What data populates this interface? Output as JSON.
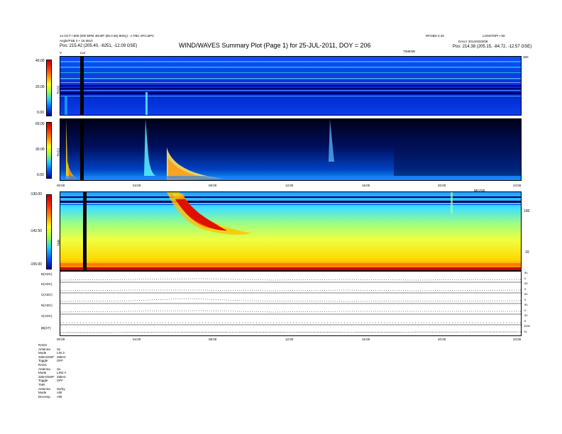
{
  "header": {
    "title": "WIND/WAVES Summary Plot (Page 1) for 25-JUL-2011, DOY = 206",
    "left_line1": "14 OCT • 805 (000 BPM 4M.BP (80.0 80) 80Gy) - A FBC 0FG.BPC",
    "left_line2": "Angle/FSB 3 + 15 0810",
    "left_line3": "Pos: 215.42 (205.40, -8251, -12.09 GSE)",
    "right_line1": "RFOBD 0.40",
    "right_line1b": "LOSSTOPI • 50",
    "right_line2": "DAILY 2014/2020/08",
    "right_line3": "Pos: 214.38 (205.15, -84.72, -12.57 GSE)",
    "time_label": "TIMENR",
    "cal_label": "Cal",
    "corner_left": "V",
    "corner_right": "360"
  },
  "panels": {
    "rad2": {
      "name": "RAD2",
      "ticks": [
        "40.00",
        "20.00",
        "0.00"
      ]
    },
    "rad1": {
      "name": "RAD1",
      "ticks": [
        "60.00",
        "30.00",
        "0.00"
      ]
    },
    "tnr": {
      "name": "TNR",
      "ticks": [
        "-130.00",
        "-142.50",
        "-155.00"
      ],
      "right_ticks": [
        "100",
        "10"
      ]
    },
    "time_ticks_top": [
      "00:00",
      "04:00",
      "08:00",
      "12:00",
      "16:00",
      "20:00",
      "24:00"
    ],
    "time_ticks_bottom": [
      "00:00",
      "04:00",
      "08:00",
      "12:00",
      "16:00",
      "20:00",
      "24:00"
    ],
    "tnr_top_label": "BEVOE",
    "line_panels": [
      {
        "label": "B(ADC)",
        "right": [
          "50",
          "20",
          "0"
        ]
      },
      {
        "label": "E(ADC)",
        "right": [
          "50",
          "20",
          "0"
        ]
      },
      {
        "label": "C(ADC)",
        "right": [
          "50",
          "20",
          "0"
        ]
      },
      {
        "label": "N(ADC)",
        "right": [
          "50",
          "20",
          "0"
        ]
      },
      {
        "label": "X(ADC)",
        "right": [
          "50",
          "20",
          "0"
        ]
      },
      {
        "label": "|B|(nT)",
        "right": [
          "1000",
          "100",
          "10"
        ]
      }
    ]
  },
  "footer": {
    "rows": [
      {
        "key": "RAD2",
        "val": ""
      },
      {
        "key": "Antenna",
        "val": "Sx"
      },
      {
        "key": "Mode",
        "val": "LIN 3"
      },
      {
        "key": "32kHzDSP",
        "val": "25kHz"
      },
      {
        "key": "Toggle",
        "val": "OFF"
      },
      {
        "key": "RAD1",
        "val": ""
      },
      {
        "key": "Antenna",
        "val": "Sx"
      },
      {
        "key": "Mode",
        "val": "LIN2 A"
      },
      {
        "key": "32kHzDSP",
        "val": "25kHz"
      },
      {
        "key": "Toggle",
        "val": "OFF"
      },
      {
        "key": "TNR",
        "val": ""
      },
      {
        "key": "Antenna",
        "val": "Sx/Sy"
      },
      {
        "key": "Mode",
        "val": "A/B"
      },
      {
        "key": "Decomp",
        "val": "A/B"
      }
    ]
  },
  "colors": {
    "colorbar": [
      "#c00000",
      "#ff3000",
      "#ff9000",
      "#ffff00",
      "#a0ff40",
      "#20d0ff",
      "#0060ff",
      "#0000a0"
    ]
  },
  "chart_data": [
    {
      "type": "heatmap",
      "title": "",
      "ylabel": "RAD2",
      "ylim": [
        0,
        40
      ],
      "x_range": [
        "00:00",
        "24:00"
      ]
    },
    {
      "type": "heatmap",
      "title": "",
      "ylabel": "RAD1",
      "ylim": [
        0,
        60
      ],
      "x_range": [
        "00:00",
        "24:00"
      ]
    },
    {
      "type": "heatmap",
      "title": "",
      "ylabel": "TNR",
      "ylim": [
        -155,
        -130
      ],
      "x_range": [
        "00:00",
        "24:00"
      ]
    }
  ]
}
